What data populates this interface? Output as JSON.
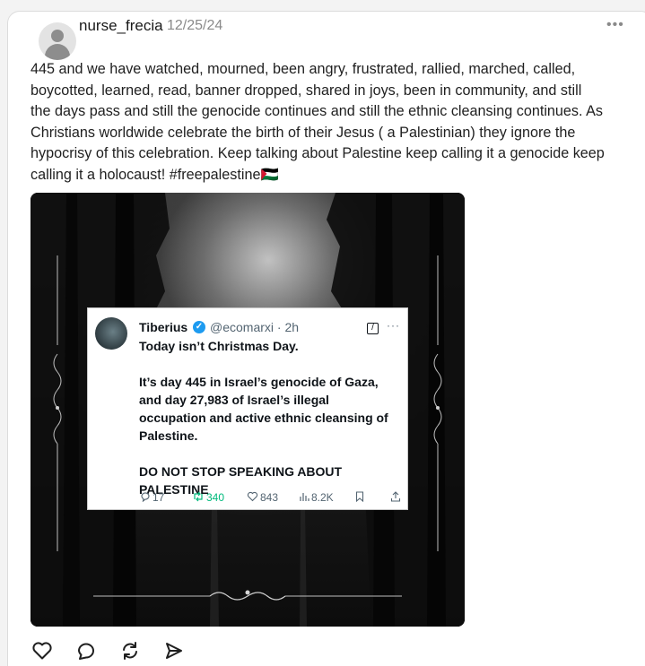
{
  "post": {
    "username": "nurse_frecia",
    "date": "12/25/24",
    "more_label": "•••",
    "lines": [
      "445 and we have watched, mourned, been angry, frustrated, rallied, marched, called,",
      "boycotted, learned, read, banner dropped, shared in joys, been in community, and still",
      "the days pass and still the genocide continues and still the ethnic cleansing continues. As",
      "Christians worldwide celebrate the birth of their Jesus ( a Palestinian) they ignore the",
      "hypocrisy of this celebration. Keep talking about Palestine keep calling it a genocide keep",
      "calling it a holocaust! #freepalestine🇵🇸"
    ]
  },
  "tweet": {
    "name": "Tiberius",
    "handle": "@ecomarxi · 2h",
    "verified_mark": "✓",
    "grok_mark": "/",
    "more_label": "···",
    "lines": [
      "Today isn’t Christmas Day.",
      "",
      "It’s day 445 in Israel’s genocide of Gaza,",
      "and day 27,983 of Israel’s illegal",
      "occupation and active ethnic cleansing of",
      "Palestine.",
      "",
      "DO NOT STOP SPEAKING ABOUT",
      "PALESTINE"
    ],
    "replies": "17",
    "reposts": "340",
    "likes": "843",
    "views": "8.2K",
    "icons": {
      "reply": "reply-icon",
      "repost": "repost-icon",
      "like": "heart-icon",
      "views": "views-icon",
      "bookmark": "bookmark-icon",
      "share": "share-icon"
    },
    "repost_color": "#00ba7c",
    "verified_color": "#1d9bf0"
  },
  "actions": {
    "icons": [
      "heart-icon",
      "comment-icon",
      "repost-icon",
      "share-icon"
    ]
  }
}
